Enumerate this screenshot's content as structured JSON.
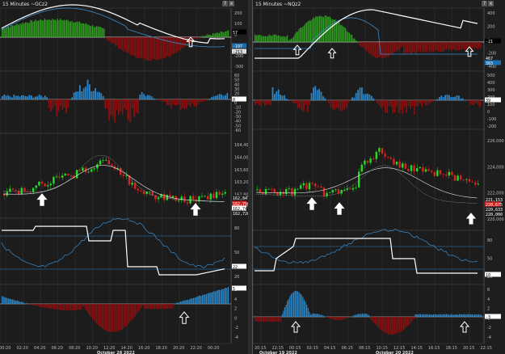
{
  "left": {
    "title": "15 Minutes ~GCz2",
    "date_label": "October 28 2022",
    "time_ticks": [
      "00:20",
      "02:20",
      "04:20",
      "06:20",
      "08:20",
      "10:20",
      "12:20",
      "14:20",
      "16:20",
      "18:20",
      "20:20",
      "22:20",
      "00:20"
    ],
    "panel1_ticks": [
      "200",
      "100",
      "0",
      "-100",
      "-200",
      "-300"
    ],
    "panel1_tags": [
      "57",
      "-197",
      "-213"
    ],
    "panel2_ticks": [
      "60",
      "50",
      "40",
      "30",
      "20",
      "10",
      "0",
      "-10",
      "-20",
      "-30",
      "-40",
      "-50",
      "-60"
    ],
    "panel2_tag": "0",
    "price_ticks": [
      "164,400",
      "164,000",
      "163,600",
      "163,200",
      "162,800",
      "162,400"
    ],
    "price_tags": [
      "162,847",
      "162,790",
      "162,745",
      "162,720"
    ],
    "panel4_ticks": [
      "80",
      "50",
      "20"
    ],
    "panel4_tag": "22",
    "panel5_ticks": [
      "6",
      "4",
      "2",
      "0",
      "-2",
      "-4"
    ],
    "panel5_tag": "5"
  },
  "right": {
    "title": "15 Minutes ~NQz2",
    "date_label_1": "October 19 2022",
    "date_label_2": "October 20 2022",
    "time_ticks": [
      "20:15",
      "22:15",
      "00:15",
      "02:15",
      "04:15",
      "06:15",
      "08:15",
      "10:15",
      "12:15",
      "14:15",
      "16:15",
      "18:15",
      "20:15",
      "22:15"
    ],
    "panel1_ticks": [
      "400",
      "200",
      "0",
      "-200",
      "-400"
    ],
    "panel1_tags": [
      "-21",
      "467",
      "383"
    ],
    "panel2_ticks": [
      "500",
      "400",
      "300",
      "200",
      "100",
      "0",
      "-100",
      "-200"
    ],
    "panel2_tag": "39",
    "price_ticks": [
      "226,000",
      "224,000",
      "222,000",
      "220,000"
    ],
    "price_tags": [
      "221,153",
      "220,675",
      "220,633",
      "220,000"
    ],
    "panel4_ticks": [
      "80",
      "50",
      "20"
    ],
    "panel4_tag": "10",
    "panel5_ticks": [
      "6",
      "4",
      "2",
      "0",
      "-2",
      "-4"
    ],
    "panel5_tag": "-3"
  },
  "window_buttons": [
    "?",
    "x"
  ],
  "colors": {
    "green_hist": "#2e9e1e",
    "red_hist": "#8a1010",
    "blue_hist": "#2a86c8",
    "candle_up": "#22dd22",
    "candle_down": "#dd2222",
    "ema_line": "#ffffff"
  }
}
